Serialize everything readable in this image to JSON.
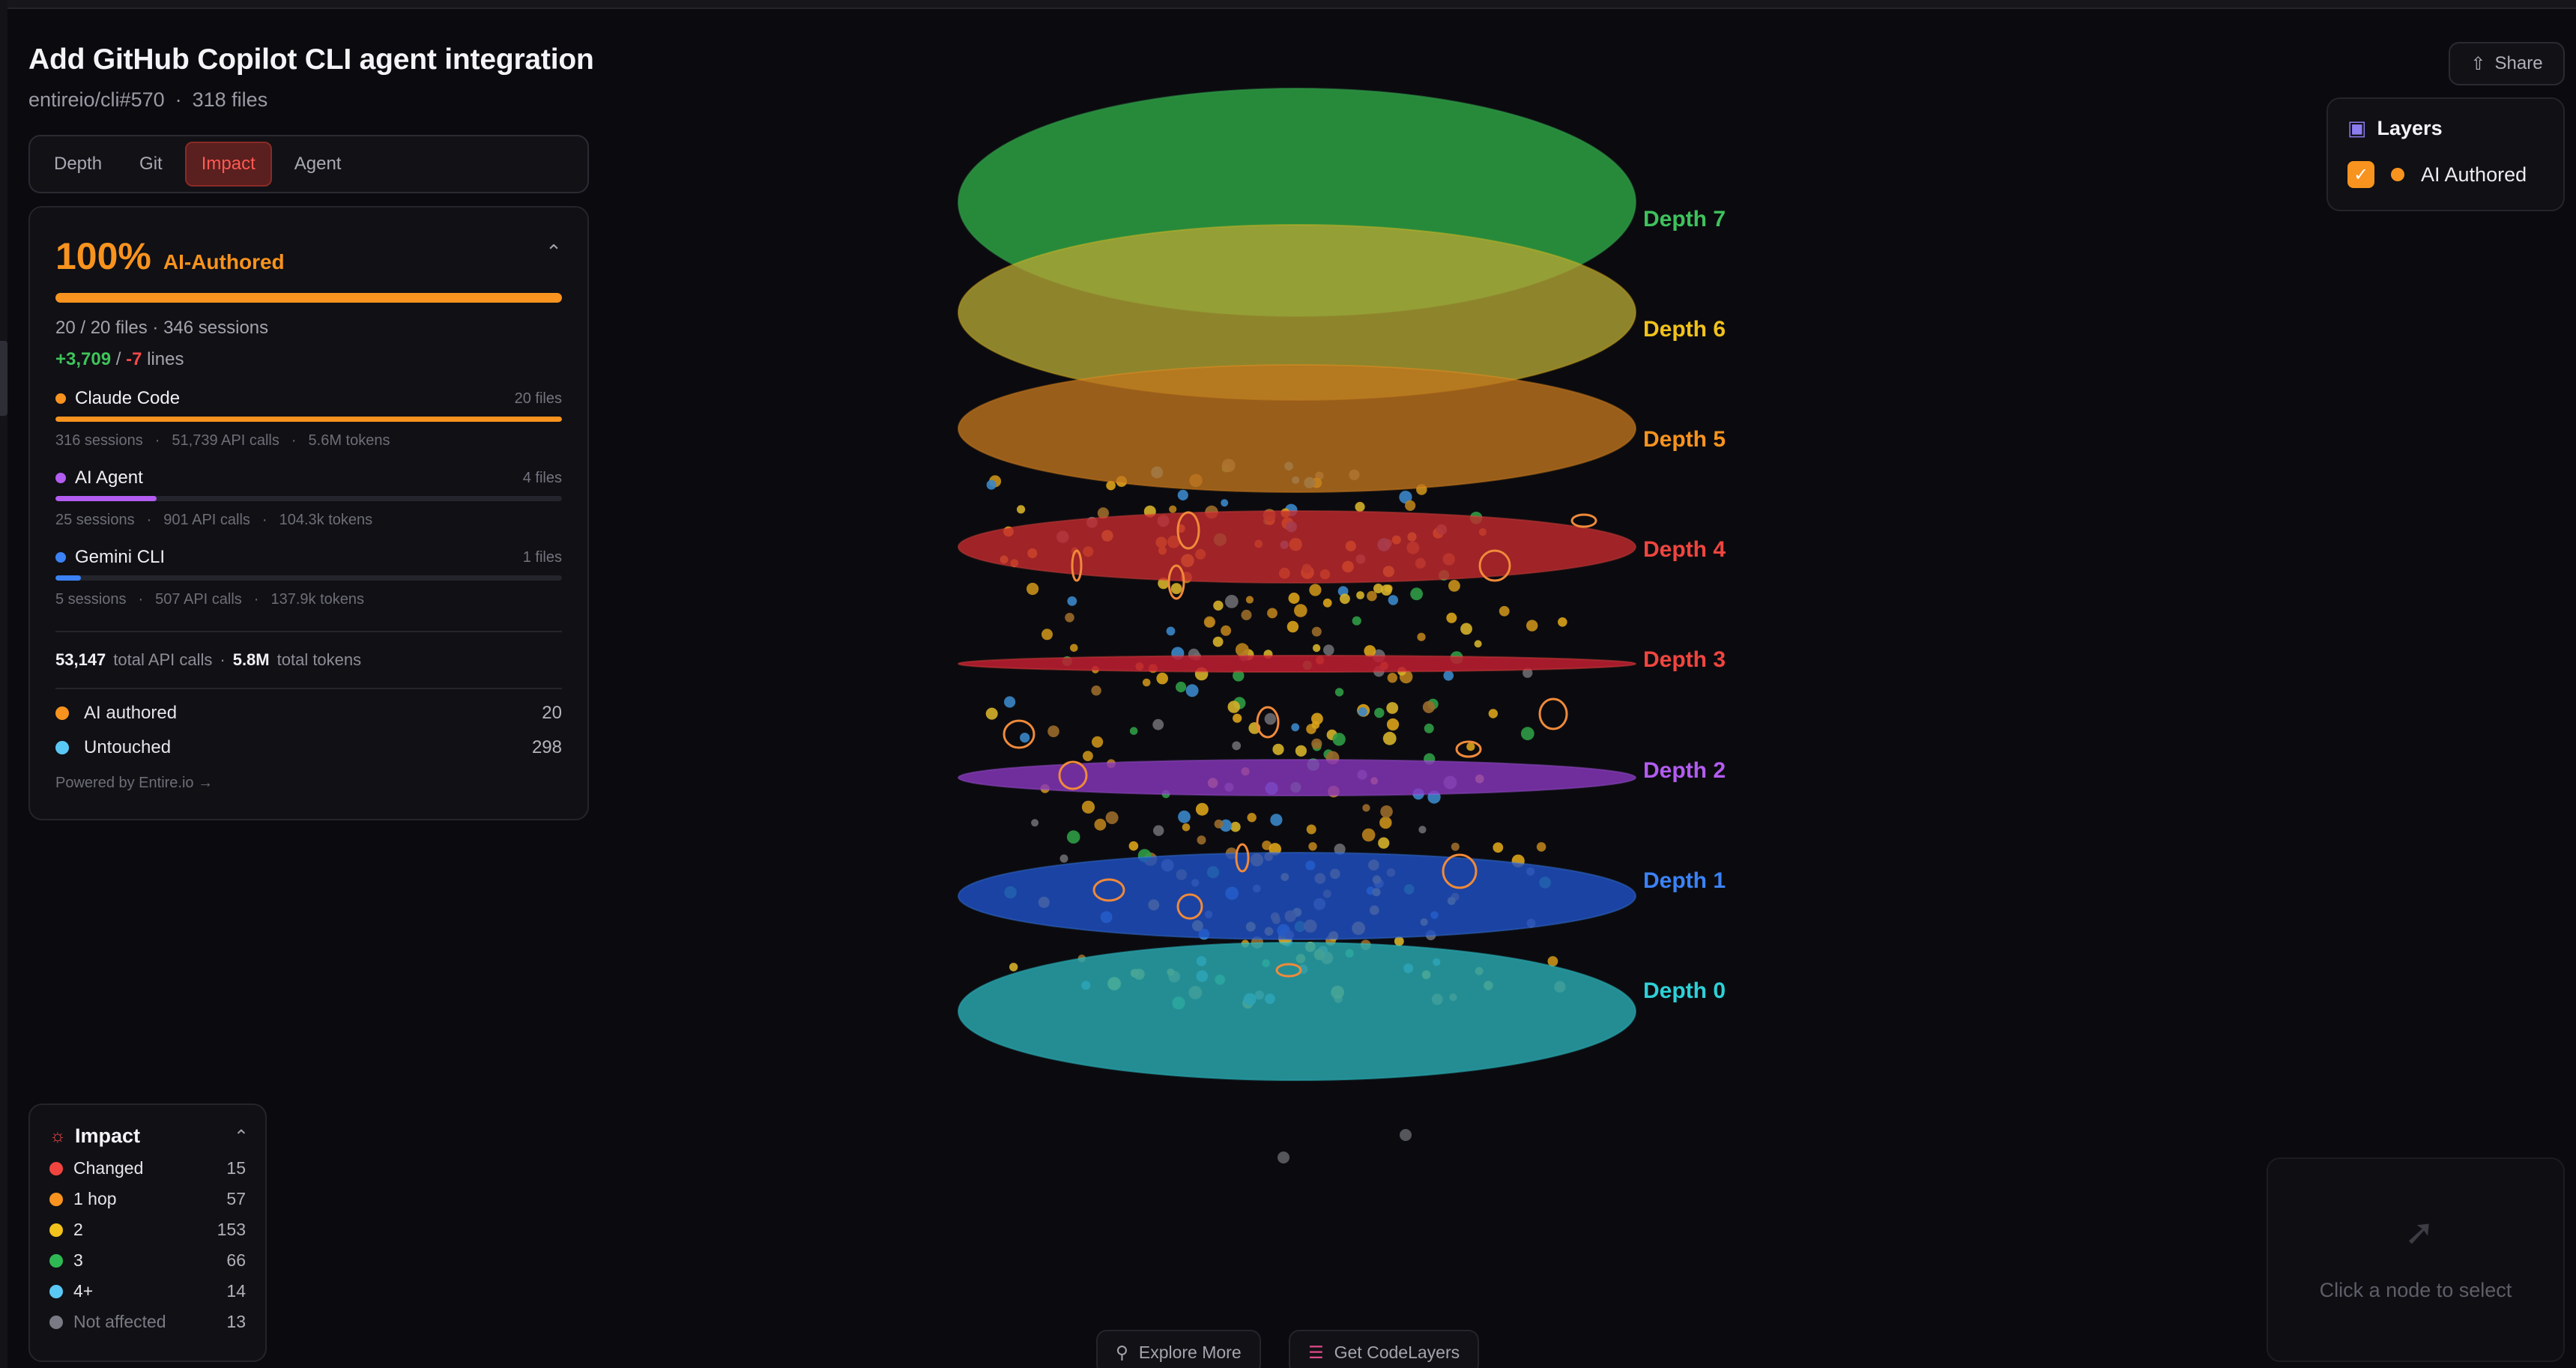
{
  "header": {
    "title": "Add GitHub Copilot CLI agent integration",
    "repo": "entireio/cli#570",
    "separator": "·",
    "files": "318 files"
  },
  "tabs": [
    "Depth",
    "Git",
    "Impact",
    "Agent"
  ],
  "active_tab": "Impact",
  "impact": {
    "percent": "100%",
    "percent_label": "AI-Authored",
    "percent_value": 1.0,
    "summary": "20 / 20 files · 346 sessions",
    "added": "+3,709",
    "slash": "/",
    "removed": "-7",
    "lines_suffix": "lines",
    "agents": [
      {
        "name": "Claude Code",
        "files": "20 files",
        "color": "#f7931e",
        "fill": 1.0,
        "sessions": "316 sessions",
        "api": "51,739 API calls",
        "tokens": "5.6M tokens"
      },
      {
        "name": "AI Agent",
        "files": "4 files",
        "color": "#b25cf0",
        "fill": 0.2,
        "sessions": "25 sessions",
        "api": "901 API calls",
        "tokens": "104.3k tokens"
      },
      {
        "name": "Gemini CLI",
        "files": "1 files",
        "color": "#3b82f6",
        "fill": 0.05,
        "sessions": "5 sessions",
        "api": "507 API calls",
        "tokens": "137.9k tokens"
      }
    ],
    "meta_sep": "·",
    "totals": {
      "api_value": "53,147",
      "api_label": "total API calls",
      "tokens_value": "5.8M",
      "tokens_label": "total tokens"
    },
    "legend": [
      {
        "label": "AI authored",
        "count": "20",
        "color": "#f7931e"
      },
      {
        "label": "Untouched",
        "count": "298",
        "color": "#5ac8f5"
      }
    ],
    "powered": "Powered by Entire.io →"
  },
  "impact_legend": {
    "title": "Impact",
    "rows": [
      {
        "label": "Changed",
        "count": "15",
        "color": "#f0453f"
      },
      {
        "label": "1 hop",
        "count": "57",
        "color": "#f7931e"
      },
      {
        "label": "2",
        "count": "153",
        "color": "#f2c21c"
      },
      {
        "label": "3",
        "count": "66",
        "color": "#2fb955"
      },
      {
        "label": "4+",
        "count": "14",
        "color": "#5ac8f5"
      },
      {
        "label": "Not affected",
        "count": "13",
        "color": "#7a7a84"
      }
    ]
  },
  "share_label": "Share",
  "layers": {
    "title": "Layers",
    "item": "AI Authored",
    "checked": true,
    "color": "#f7931e"
  },
  "select_hint": "Click a node to select",
  "bottom": {
    "explore": "Explore More",
    "get": "Get CodeLayers"
  },
  "depth_layers": [
    {
      "label": "Depth 7",
      "color": "#2fae48",
      "text": "#3ec25c"
    },
    {
      "label": "Depth 6",
      "color": "#b3a634",
      "text": "#f2c21c"
    },
    {
      "label": "Depth 5",
      "color": "#c1761e",
      "text": "#f7931e"
    },
    {
      "label": "Depth 4",
      "color": "#c42a2e",
      "text": "#f0453f"
    },
    {
      "label": "Depth 3",
      "color": "#c01e32",
      "text": "#f0453f"
    },
    {
      "label": "Depth 2",
      "color": "#8a36c0",
      "text": "#b25cf0"
    },
    {
      "label": "Depth 1",
      "color": "#1f52c8",
      "text": "#3b82f6"
    },
    {
      "label": "Depth 0",
      "color": "#2aaab2",
      "text": "#2ed0d8"
    }
  ]
}
